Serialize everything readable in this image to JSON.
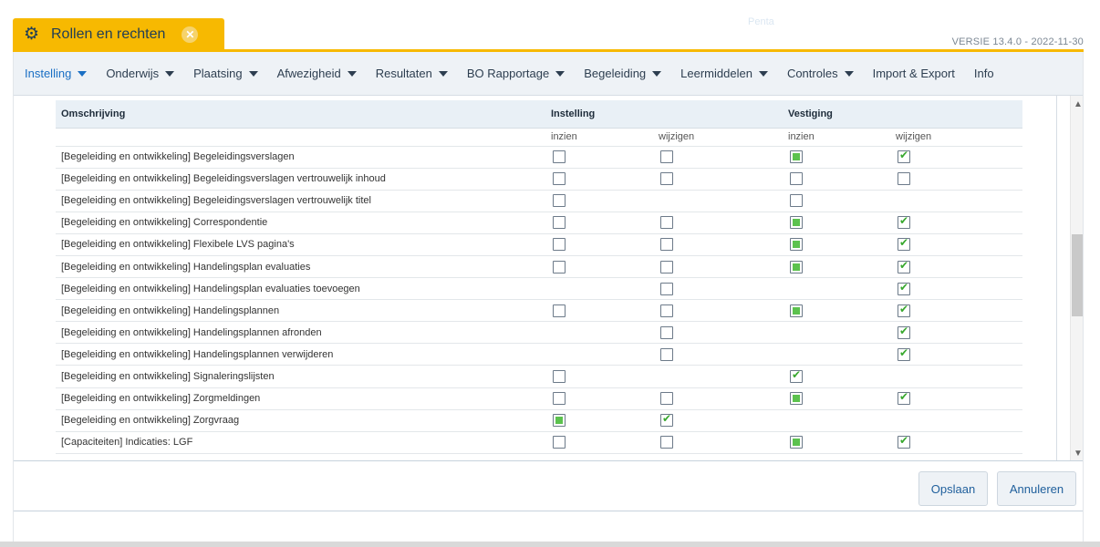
{
  "window": {
    "tab_title": "Rollen en rechten",
    "topbar_faint_text": "Penta",
    "version": "VERSIE 13.4.0 - 2022-11-30"
  },
  "menu": [
    {
      "label": "Instelling",
      "dropdown": true,
      "active": true
    },
    {
      "label": "Onderwijs",
      "dropdown": true
    },
    {
      "label": "Plaatsing",
      "dropdown": true
    },
    {
      "label": "Afwezigheid",
      "dropdown": true
    },
    {
      "label": "Resultaten",
      "dropdown": true
    },
    {
      "label": "BO Rapportage",
      "dropdown": true
    },
    {
      "label": "Begeleiding",
      "dropdown": true
    },
    {
      "label": "Leermiddelen",
      "dropdown": true
    },
    {
      "label": "Controles",
      "dropdown": true
    },
    {
      "label": "Import & Export",
      "dropdown": false
    },
    {
      "label": "Info",
      "dropdown": false
    }
  ],
  "table": {
    "headers": {
      "omschrijving": "Omschrijving",
      "instelling": "Instelling",
      "vestiging": "Vestiging"
    },
    "subheaders": [
      "inzien",
      "wijzigen",
      "inzien",
      "wijzigen"
    ],
    "rows": [
      {
        "label": "[Begeleiding en ontwikkeling] Begeleidingsverslagen",
        "cells": [
          "empty",
          "empty",
          "ind",
          "check"
        ]
      },
      {
        "label": "[Begeleiding en ontwikkeling] Begeleidingsverslagen vertrouwelijk inhoud",
        "cells": [
          "empty",
          "empty",
          "empty",
          "empty"
        ]
      },
      {
        "label": "[Begeleiding en ontwikkeling] Begeleidingsverslagen vertrouwelijk titel",
        "cells": [
          "empty",
          "none",
          "empty",
          "none"
        ]
      },
      {
        "label": "[Begeleiding en ontwikkeling] Correspondentie",
        "cells": [
          "empty",
          "empty",
          "ind",
          "check"
        ]
      },
      {
        "label": "[Begeleiding en ontwikkeling] Flexibele LVS pagina's",
        "cells": [
          "empty",
          "empty",
          "ind",
          "check"
        ]
      },
      {
        "label": "[Begeleiding en ontwikkeling] Handelingsplan evaluaties",
        "cells": [
          "empty",
          "empty",
          "ind",
          "check"
        ]
      },
      {
        "label": "[Begeleiding en ontwikkeling] Handelingsplan evaluaties toevoegen",
        "cells": [
          "none",
          "empty",
          "none",
          "check"
        ]
      },
      {
        "label": "[Begeleiding en ontwikkeling] Handelingsplannen",
        "cells": [
          "empty",
          "empty",
          "ind",
          "check"
        ]
      },
      {
        "label": "[Begeleiding en ontwikkeling] Handelingsplannen afronden",
        "cells": [
          "none",
          "empty",
          "none",
          "check"
        ]
      },
      {
        "label": "[Begeleiding en ontwikkeling] Handelingsplannen verwijderen",
        "cells": [
          "none",
          "empty",
          "none",
          "check"
        ]
      },
      {
        "label": "[Begeleiding en ontwikkeling] Signaleringslijsten",
        "cells": [
          "empty",
          "none",
          "check",
          "none"
        ]
      },
      {
        "label": "[Begeleiding en ontwikkeling] Zorgmeldingen",
        "cells": [
          "empty",
          "empty",
          "ind",
          "check"
        ]
      },
      {
        "label": "[Begeleiding en ontwikkeling] Zorgvraag",
        "cells": [
          "ind",
          "check",
          "none",
          "none"
        ]
      },
      {
        "label": "[Capaciteiten] Indicaties: LGF",
        "cells": [
          "empty",
          "empty",
          "ind",
          "check"
        ]
      }
    ]
  },
  "buttons": {
    "save": "Opslaan",
    "cancel": "Annuleren"
  },
  "colors": {
    "accent_yellow": "#f7b901",
    "menu_bg": "#eef2f6",
    "active_link": "#1a6fc4",
    "check_green": "#38a82e"
  }
}
